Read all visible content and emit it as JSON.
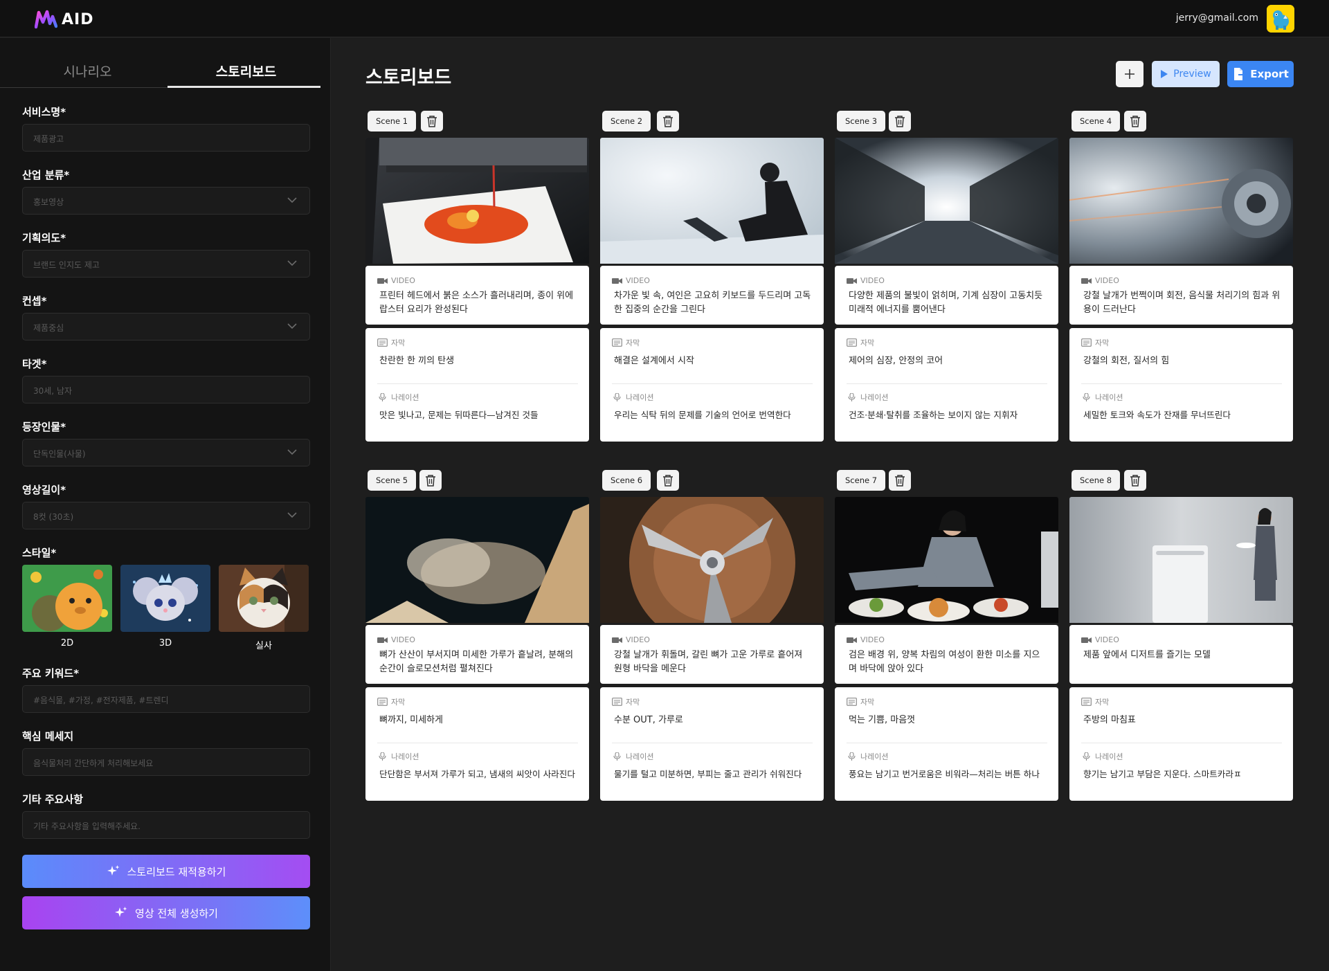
{
  "header": {
    "logo_text": "AID",
    "user_email": "jerry@gmail.com"
  },
  "sidebar": {
    "tabs": [
      {
        "label": "시나리오",
        "active": false
      },
      {
        "label": "스토리보드",
        "active": true
      }
    ],
    "fields": [
      {
        "label": "서비스명*",
        "placeholder": "제품광고",
        "type": "text"
      },
      {
        "label": "산업 분류*",
        "value": "홍보영상",
        "type": "select"
      },
      {
        "label": "기획의도*",
        "value": "브랜드 인지도 제고",
        "type": "select"
      },
      {
        "label": "컨셉*",
        "value": "제품중심",
        "type": "select"
      },
      {
        "label": "타겟*",
        "placeholder": "30세, 남자",
        "type": "text"
      },
      {
        "label": "등장인물*",
        "value": "단독인물(사물)",
        "type": "select"
      },
      {
        "label": "영상길이*",
        "value": "8컷 (30초)",
        "type": "select"
      }
    ],
    "style": {
      "label": "스타일*",
      "options": [
        {
          "label": "2D",
          "icon": "2d-capybara-thumb"
        },
        {
          "label": "3D",
          "icon": "3d-mouse-thumb"
        },
        {
          "label": "실사",
          "icon": "realistic-cat-thumb"
        }
      ]
    },
    "fields2": [
      {
        "label": "주요 키워드*",
        "placeholder": "#음식물, #가정, #전자제품, #트렌디"
      },
      {
        "label": "핵심 메세지",
        "placeholder": "음식물처리 간단하게 처리해보세요"
      },
      {
        "label": "기타 주요사항",
        "placeholder": "기타 주요사항을 입력해주세요."
      }
    ],
    "buttons": {
      "reapply": "스토리보드 재적용하기",
      "generate": "영상 전체 생성하기"
    }
  },
  "main": {
    "title": "스토리보드",
    "preview_label": "Preview",
    "export_label": "Export",
    "video_label": "VIDEO",
    "caption_label": "자막",
    "narration_label": "나레이션",
    "scenes": [
      {
        "tag": "Scene 1",
        "video": "프린터 헤드에서 붉은 소스가 흘러내리며, 종이 위에 랍스터 요리가 완성된다",
        "caption": "찬란한 한 끼의 탄생",
        "narration": "맛은 빛나고, 문제는 뒤따른다—남겨진 것들"
      },
      {
        "tag": "Scene 2",
        "video": "차가운 빛 속, 여인은 고요히 키보드를 두드리며 고독한 집중의 순간을 그린다",
        "caption": "해결은 설계에서 시작",
        "narration": "우리는 식탁 뒤의 문제를 기술의 언어로 번역한다"
      },
      {
        "tag": "Scene 3",
        "video": "다양한 제품의 불빛이 얽히며, 기계 심장이 고동치듯 미래적 에너지를 뿜어낸다",
        "caption": "제어의 심장, 안정의 코어",
        "narration": "건조·분쇄·탈취를 조율하는 보이지 않는 지휘자"
      },
      {
        "tag": "Scene 4",
        "video": "강철 날개가 번쩍이며 회전, 음식물 처리기의 힘과 위용이 드러난다",
        "caption": "강철의 회전, 질서의 힘",
        "narration": "세밀한 토크와 속도가 잔재를 무너뜨린다"
      },
      {
        "tag": "Scene 5",
        "video": "뼈가 산산이 부서지며 미세한 가루가 흩날려, 분해의 순간이 슬로모션처럼 펼쳐진다",
        "caption": "뼈까지, 미세하게",
        "narration": "단단함은 부서져 가루가 되고, 냄새의 씨앗이 사라진다"
      },
      {
        "tag": "Scene 6",
        "video": "강철 날개가 휘돌며, 갈린 뼈가 고운 가루로 흩어져 원형 바닥을 메운다",
        "caption": "수분 OUT, 가루로",
        "narration": "물기를 털고 미분하면, 부피는 줄고 관리가 쉬워진다"
      },
      {
        "tag": "Scene 7",
        "video": "검은 배경 위, 양복 차림의 여성이 환한 미소를 지으며 바닥에 앉아 있다",
        "caption": "먹는 기쁨, 마음껏",
        "narration": "풍요는 남기고 번거로움은 비워라—처리는 버튼 하나"
      },
      {
        "tag": "Scene 8",
        "video": "제품 앞에서 디저트를 즐기는 모델",
        "caption": "주방의 마침표",
        "narration": "향기는 남기고 부담은 지운다. 스마트카라ㅍ"
      }
    ]
  }
}
